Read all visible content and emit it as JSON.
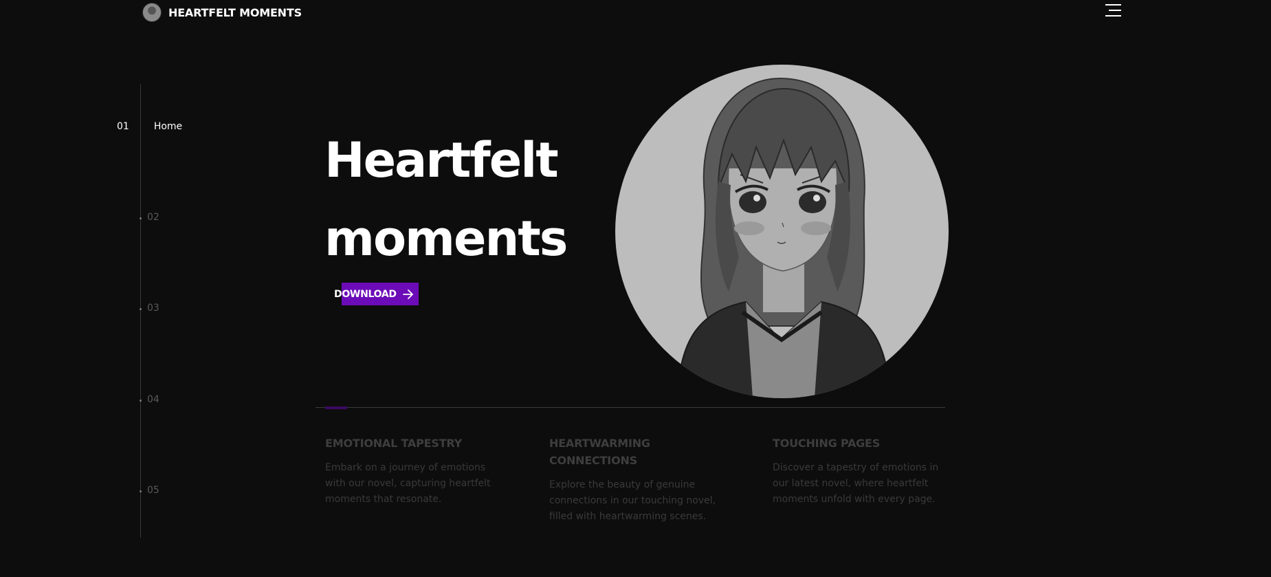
{
  "header": {
    "brand_title": "HEARTFELT MOMENTS",
    "logo_icon": "avatar-logo-icon",
    "menu_icon": "hamburger-icon"
  },
  "side_nav": {
    "items": [
      {
        "num": "01",
        "label": "Home",
        "active": true
      },
      {
        "num": "02",
        "label": "",
        "active": false
      },
      {
        "num": "03",
        "label": "",
        "active": false
      },
      {
        "num": "04",
        "label": "",
        "active": false
      },
      {
        "num": "05",
        "label": "",
        "active": false
      }
    ]
  },
  "hero": {
    "title_line1": "Heartfelt",
    "title_line2": "moments",
    "download_label": "DOWNLOAD",
    "download_icon": "arrow-right-icon",
    "portrait_icon": "anime-girl-portrait"
  },
  "features": [
    {
      "title": "EMOTIONAL TAPESTRY",
      "text": "Embark on a journey of emotions with our novel, capturing heartfelt moments that resonate."
    },
    {
      "title": "HEARTWARMING CONNECTIONS",
      "text": "Explore the beauty of genuine connections in our touching novel, filled with heartwarming scenes."
    },
    {
      "title": "TOUCHING PAGES",
      "text": "Discover a tapestry of emotions in our latest novel, where heartfelt moments unfold with every page."
    }
  ],
  "colors": {
    "background": "#0d0d0d",
    "accent": "#6c0bb8",
    "muted_text": "#3e3e3e"
  }
}
